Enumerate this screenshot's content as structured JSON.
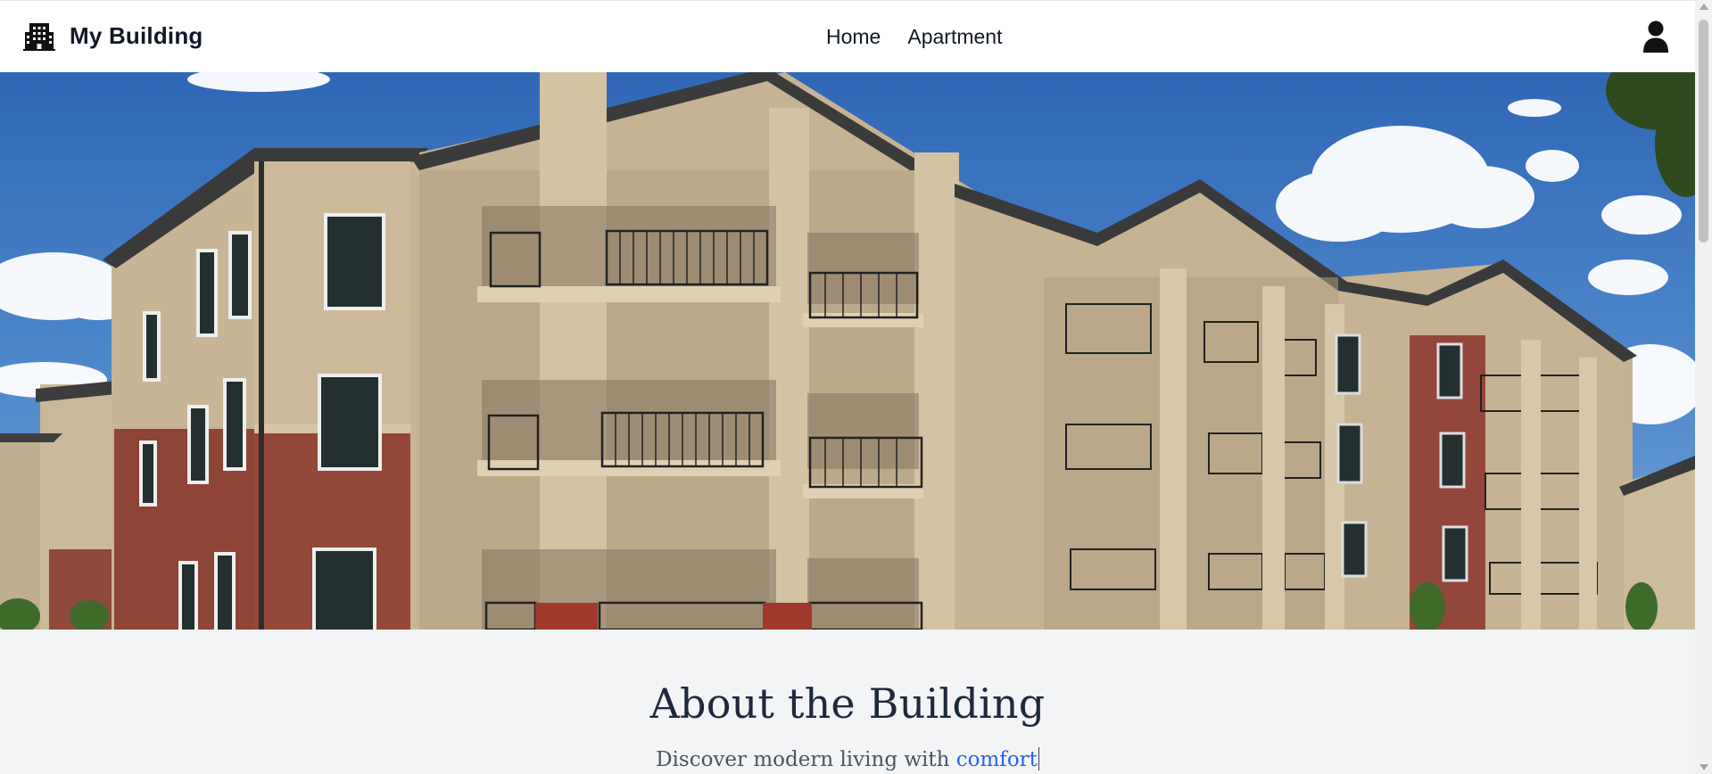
{
  "brand": {
    "name": "My Building",
    "icon": "building-icon"
  },
  "nav": {
    "links": [
      "Home",
      "Apartment"
    ]
  },
  "profile": {
    "icon": "user-icon"
  },
  "hero": {
    "image": "apartment-building-photo"
  },
  "about": {
    "title": "About the Building",
    "subtitle_prefix": "Discover modern living with ",
    "subtitle_highlight": "comfort"
  },
  "colors": {
    "accent": "#2563eb",
    "heading": "#1e293b",
    "page_bg": "#f3f4f6"
  }
}
